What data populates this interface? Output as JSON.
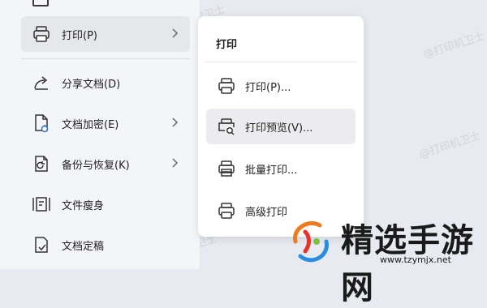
{
  "menu": {
    "items": [
      {
        "label": "打印(P)",
        "icon": "printer-icon",
        "has_submenu": true,
        "active": true
      },
      {
        "label": "分享文档(D)",
        "icon": "share-icon",
        "has_submenu": false
      },
      {
        "label": "文档加密(E)",
        "icon": "encrypt-doc-icon",
        "has_submenu": true
      },
      {
        "label": "备份与恢复(K)",
        "icon": "backup-icon",
        "has_submenu": true
      },
      {
        "label": "文件瘦身",
        "icon": "slim-file-icon",
        "has_submenu": false
      },
      {
        "label": "文档定稿",
        "icon": "finalize-doc-icon",
        "has_submenu": false
      }
    ]
  },
  "submenu": {
    "title": "打印",
    "items": [
      {
        "label": "打印(P)...",
        "icon": "printer-icon"
      },
      {
        "label": "打印预览(V)...",
        "icon": "print-preview-icon",
        "active": true
      },
      {
        "label": "批量打印...",
        "icon": "batch-print-icon"
      },
      {
        "label": "高级打印",
        "icon": "advanced-print-icon"
      }
    ]
  },
  "watermark": {
    "text": "@打印机卫士"
  },
  "logo": {
    "text": "精选手游网",
    "url": "www.tzymjx.net"
  },
  "colors": {
    "accent_orange": "#f07a1a",
    "accent_blue": "#2a8de0",
    "accent_red": "#e8322c"
  }
}
